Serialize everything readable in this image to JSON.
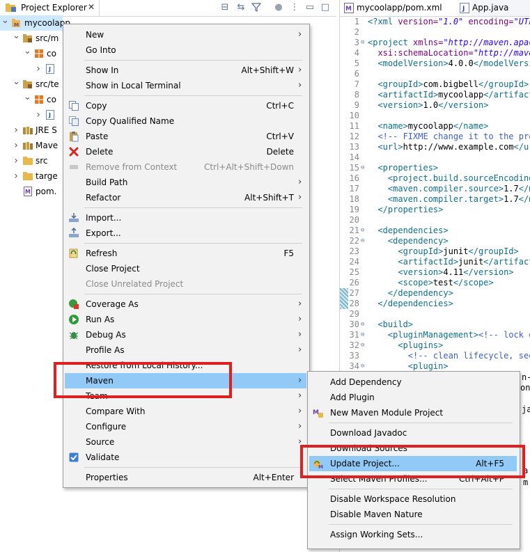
{
  "explorer": {
    "tab_label": "Project Explorer",
    "tree": [
      {
        "label": "mycoolapp",
        "indent": 0,
        "icon": "project-icon",
        "expanded": true
      },
      {
        "label": "src/m",
        "indent": 1,
        "icon": "source-folder-icon",
        "expanded": true
      },
      {
        "label": "co",
        "indent": 2,
        "icon": "package-icon",
        "expanded": true
      },
      {
        "label": "",
        "indent": 3,
        "icon": "java-file-icon",
        "expanded": false
      },
      {
        "label": "src/te",
        "indent": 1,
        "icon": "source-folder-icon",
        "expanded": true
      },
      {
        "label": "co",
        "indent": 2,
        "icon": "package-icon",
        "expanded": true
      },
      {
        "label": "",
        "indent": 3,
        "icon": "java-file-icon",
        "expanded": false
      },
      {
        "label": "JRE S",
        "indent": 1,
        "icon": "library-icon",
        "expanded": false
      },
      {
        "label": "Mave",
        "indent": 1,
        "icon": "library-icon",
        "expanded": false
      },
      {
        "label": "src",
        "indent": 1,
        "icon": "folder-icon",
        "expanded": false
      },
      {
        "label": "targe",
        "indent": 1,
        "icon": "folder-icon",
        "expanded": false
      },
      {
        "label": "pom.",
        "indent": 1,
        "icon": "maven-file-icon",
        "expanded": null
      }
    ]
  },
  "editor": {
    "tabs": [
      {
        "label": "mycoolapp/pom.xml",
        "active": true
      },
      {
        "label": "App.java",
        "active": false
      }
    ],
    "lines": [
      {
        "n": "1",
        "parts": [
          [
            "pi",
            "<?xml "
          ],
          [
            "attr",
            "version="
          ],
          [
            "str",
            "\"1.0\""
          ],
          [
            "attr",
            " encoding="
          ],
          [
            "str",
            "\"UTF-"
          ]
        ]
      },
      {
        "n": "2",
        "parts": []
      },
      {
        "n": "3",
        "fold": true,
        "parts": [
          [
            "tag",
            "<project "
          ],
          [
            "attr",
            "xmlns="
          ],
          [
            "str",
            "\"http://maven.apach"
          ]
        ]
      },
      {
        "n": "4",
        "parts": [
          [
            "attr",
            "  xsi:schemaLocation="
          ],
          [
            "str",
            "\"http://maven"
          ]
        ]
      },
      {
        "n": "5",
        "parts": [
          [
            "tag",
            "  <modelVersion>"
          ],
          [
            "txt",
            "4.0.0"
          ],
          [
            "tag",
            "</modelVersio"
          ]
        ]
      },
      {
        "n": "6",
        "parts": []
      },
      {
        "n": "7",
        "parts": [
          [
            "tag",
            "  <groupId>"
          ],
          [
            "txt",
            "com.bigbell"
          ],
          [
            "tag",
            "</groupId>"
          ]
        ]
      },
      {
        "n": "8",
        "parts": [
          [
            "tag",
            "  <artifactId>"
          ],
          [
            "txt",
            "mycoolapp"
          ],
          [
            "tag",
            "</artifact"
          ]
        ]
      },
      {
        "n": "9",
        "parts": [
          [
            "tag",
            "  <version>"
          ],
          [
            "txt",
            "1.0"
          ],
          [
            "tag",
            "</version>"
          ]
        ]
      },
      {
        "n": "10",
        "parts": []
      },
      {
        "n": "11",
        "parts": [
          [
            "tag",
            "  <name>"
          ],
          [
            "txt",
            "mycoolapp"
          ],
          [
            "tag",
            "</name>"
          ]
        ]
      },
      {
        "n": "12",
        "parts": [
          [
            "cm",
            "  <!-- FIXME change it to the proj"
          ]
        ]
      },
      {
        "n": "13",
        "parts": [
          [
            "tag",
            "  <url>"
          ],
          [
            "txt",
            "http://www.example.com"
          ],
          [
            "tag",
            "</ur"
          ]
        ]
      },
      {
        "n": "14",
        "parts": []
      },
      {
        "n": "15",
        "fold": true,
        "parts": [
          [
            "tag",
            "  <properties>"
          ]
        ]
      },
      {
        "n": "16",
        "parts": [
          [
            "tag",
            "    <project.build.sourceEncoding"
          ]
        ]
      },
      {
        "n": "17",
        "parts": [
          [
            "tag",
            "    <maven.compiler.source>"
          ],
          [
            "txt",
            "1.7"
          ],
          [
            "tag",
            "</ma"
          ]
        ]
      },
      {
        "n": "18",
        "parts": [
          [
            "tag",
            "    <maven.compiler.target>"
          ],
          [
            "txt",
            "1.7"
          ],
          [
            "tag",
            "</ma"
          ]
        ]
      },
      {
        "n": "19",
        "parts": [
          [
            "tag",
            "  </properties>"
          ]
        ]
      },
      {
        "n": "20",
        "parts": []
      },
      {
        "n": "21",
        "fold": true,
        "parts": [
          [
            "tag",
            "  <dependencies>"
          ]
        ]
      },
      {
        "n": "22",
        "fold": true,
        "parts": [
          [
            "tag",
            "    <dependency>"
          ]
        ]
      },
      {
        "n": "23",
        "parts": [
          [
            "tag",
            "      <groupId>"
          ],
          [
            "txt",
            "junit"
          ],
          [
            "tag",
            "</groupId>"
          ]
        ]
      },
      {
        "n": "24",
        "parts": [
          [
            "tag",
            "      <artifactId>"
          ],
          [
            "txt",
            "junit"
          ],
          [
            "tag",
            "</artifact"
          ]
        ]
      },
      {
        "n": "25",
        "parts": [
          [
            "tag",
            "      <version>"
          ],
          [
            "txt",
            "4.11"
          ],
          [
            "tag",
            "</version>"
          ]
        ]
      },
      {
        "n": "26",
        "parts": [
          [
            "tag",
            "      <scope>"
          ],
          [
            "txt",
            "test"
          ],
          [
            "tag",
            "</scope>"
          ]
        ]
      },
      {
        "n": "27",
        "parts": [
          [
            "tag",
            "    </dependency>"
          ]
        ]
      },
      {
        "n": "28",
        "parts": [
          [
            "tag",
            "  </dependencies>"
          ]
        ]
      },
      {
        "n": "29",
        "parts": []
      },
      {
        "n": "30",
        "fold": true,
        "parts": [
          [
            "tag",
            "  <build>"
          ]
        ]
      },
      {
        "n": "31",
        "fold": true,
        "parts": [
          [
            "tag",
            "    <pluginManagement>"
          ],
          [
            "cm",
            "<!-- lock do"
          ]
        ]
      },
      {
        "n": "32",
        "fold": true,
        "parts": [
          [
            "tag",
            "      <plugins>"
          ]
        ]
      },
      {
        "n": "33",
        "parts": [
          [
            "cm",
            "        <!-- clean lifecycle, see"
          ]
        ]
      },
      {
        "n": "34",
        "fold": true,
        "parts": [
          [
            "tag",
            "        <plugin>"
          ]
        ]
      }
    ],
    "peek_fragments": [
      "n-",
      "on>",
      "ja",
      "a",
      "m"
    ]
  },
  "context_menu": {
    "items": [
      {
        "type": "item",
        "label": "New",
        "accel": "",
        "submenu": true,
        "icon": "",
        "disabled": false
      },
      {
        "type": "item",
        "label": "Go Into",
        "accel": "",
        "submenu": false,
        "icon": "",
        "disabled": false
      },
      {
        "type": "sep"
      },
      {
        "type": "item",
        "label": "Show In",
        "accel": "Alt+Shift+W",
        "submenu": true,
        "icon": "",
        "disabled": false
      },
      {
        "type": "item",
        "label": "Show in Local Terminal",
        "accel": "",
        "submenu": true,
        "icon": "",
        "disabled": false
      },
      {
        "type": "sep"
      },
      {
        "type": "item",
        "label": "Copy",
        "accel": "Ctrl+C",
        "submenu": false,
        "icon": "copy-icon",
        "disabled": false
      },
      {
        "type": "item",
        "label": "Copy Qualified Name",
        "accel": "",
        "submenu": false,
        "icon": "copy-qualified-icon",
        "disabled": false
      },
      {
        "type": "item",
        "label": "Paste",
        "accel": "Ctrl+V",
        "submenu": false,
        "icon": "paste-icon",
        "disabled": false
      },
      {
        "type": "item",
        "label": "Delete",
        "accel": "Delete",
        "submenu": false,
        "icon": "delete-icon",
        "disabled": false
      },
      {
        "type": "item",
        "label": "Remove from Context",
        "accel": "Ctrl+Alt+Shift+Down",
        "submenu": false,
        "icon": "remove-icon",
        "disabled": true
      },
      {
        "type": "item",
        "label": "Build Path",
        "accel": "",
        "submenu": true,
        "icon": "",
        "disabled": false
      },
      {
        "type": "item",
        "label": "Refactor",
        "accel": "Alt+Shift+T",
        "submenu": true,
        "icon": "",
        "disabled": false
      },
      {
        "type": "sep"
      },
      {
        "type": "item",
        "label": "Import...",
        "accel": "",
        "submenu": false,
        "icon": "import-icon",
        "disabled": false
      },
      {
        "type": "item",
        "label": "Export...",
        "accel": "",
        "submenu": false,
        "icon": "export-icon",
        "disabled": false
      },
      {
        "type": "sep"
      },
      {
        "type": "item",
        "label": "Refresh",
        "accel": "F5",
        "submenu": false,
        "icon": "refresh-icon",
        "disabled": false
      },
      {
        "type": "item",
        "label": "Close Project",
        "accel": "",
        "submenu": false,
        "icon": "",
        "disabled": false
      },
      {
        "type": "item",
        "label": "Close Unrelated Project",
        "accel": "",
        "submenu": false,
        "icon": "",
        "disabled": true
      },
      {
        "type": "sep"
      },
      {
        "type": "item",
        "label": "Coverage As",
        "accel": "",
        "submenu": true,
        "icon": "coverage-icon",
        "disabled": false
      },
      {
        "type": "item",
        "label": "Run As",
        "accel": "",
        "submenu": true,
        "icon": "run-icon",
        "disabled": false
      },
      {
        "type": "item",
        "label": "Debug As",
        "accel": "",
        "submenu": true,
        "icon": "debug-icon",
        "disabled": false
      },
      {
        "type": "item",
        "label": "Profile As",
        "accel": "",
        "submenu": true,
        "icon": "",
        "disabled": false
      },
      {
        "type": "item",
        "label": "Restore from Local History...",
        "accel": "",
        "submenu": false,
        "icon": "",
        "disabled": false
      },
      {
        "type": "item",
        "label": "Maven",
        "accel": "",
        "submenu": true,
        "icon": "",
        "disabled": false,
        "highlighted": true
      },
      {
        "type": "item",
        "label": "Team",
        "accel": "",
        "submenu": true,
        "icon": "",
        "disabled": false
      },
      {
        "type": "item",
        "label": "Compare With",
        "accel": "",
        "submenu": true,
        "icon": "",
        "disabled": false
      },
      {
        "type": "item",
        "label": "Configure",
        "accel": "",
        "submenu": true,
        "icon": "",
        "disabled": false
      },
      {
        "type": "item",
        "label": "Source",
        "accel": "",
        "submenu": true,
        "icon": "",
        "disabled": false
      },
      {
        "type": "item",
        "label": "Validate",
        "accel": "",
        "submenu": false,
        "icon": "check-icon",
        "disabled": false
      },
      {
        "type": "sep"
      },
      {
        "type": "item",
        "label": "Properties",
        "accel": "Alt+Enter",
        "submenu": false,
        "icon": "",
        "disabled": false
      }
    ]
  },
  "maven_submenu": {
    "items": [
      {
        "type": "item",
        "label": "Add Dependency",
        "accel": "",
        "icon": ""
      },
      {
        "type": "item",
        "label": "Add Plugin",
        "accel": "",
        "icon": ""
      },
      {
        "type": "item",
        "label": "New Maven Module Project",
        "accel": "",
        "icon": "maven-module-icon"
      },
      {
        "type": "sep"
      },
      {
        "type": "item",
        "label": "Download Javadoc",
        "accel": "",
        "icon": ""
      },
      {
        "type": "item",
        "label": "Download Sources",
        "accel": "",
        "icon": ""
      },
      {
        "type": "item",
        "label": "Update Project...",
        "accel": "Alt+F5",
        "icon": "maven-update-icon",
        "highlighted": true
      },
      {
        "type": "item",
        "label": "Select Maven Profiles...",
        "accel": "Ctrl+Alt+P",
        "icon": ""
      },
      {
        "type": "sep"
      },
      {
        "type": "item",
        "label": "Disable Workspace Resolution",
        "accel": "",
        "icon": ""
      },
      {
        "type": "item",
        "label": "Disable Maven Nature",
        "accel": "",
        "icon": ""
      },
      {
        "type": "sep"
      },
      {
        "type": "item",
        "label": "Assign Working Sets...",
        "accel": "",
        "icon": ""
      }
    ]
  },
  "colors": {
    "menu_highlight": "#91c9f7",
    "annotation_red": "#e02020",
    "xml_tag": "#0f6f8e",
    "xml_attr": "#7f007f",
    "xml_string": "#2a00ff",
    "xml_comment": "#3f5fbf"
  }
}
